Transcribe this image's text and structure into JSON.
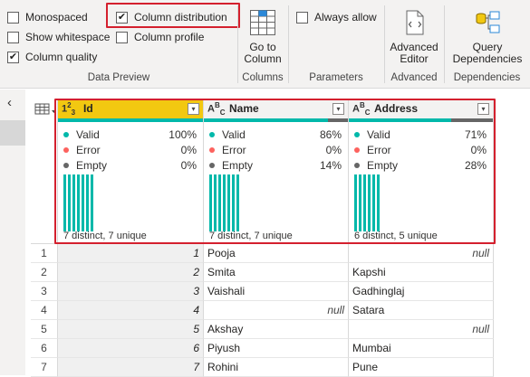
{
  "ribbon": {
    "checks": [
      {
        "label": "Monospaced",
        "checked": false
      },
      {
        "label": "Show whitespace",
        "checked": false
      },
      {
        "label": "Column quality",
        "checked": true
      },
      {
        "label": "Column distribution",
        "checked": true
      },
      {
        "label": "Column profile",
        "checked": false
      },
      {
        "label": "Always allow",
        "checked": false
      }
    ],
    "check_mark": "✔",
    "groups": {
      "data_preview": "Data Preview",
      "columns": "Columns",
      "parameters": "Parameters",
      "advanced": "Advanced",
      "dependencies": "Dependencies"
    },
    "buttons": {
      "go_to_column": [
        "Go to",
        "Column"
      ],
      "advanced_editor": [
        "Advanced",
        "Editor"
      ],
      "query_dependencies": [
        "Query",
        "Dependencies"
      ]
    }
  },
  "nav": {
    "collapse": "‹"
  },
  "columns": [
    {
      "type": "1²₃",
      "name": "Id",
      "header_bg": "#f2c811",
      "dropdown": "▾",
      "quality": [
        {
          "label": "Valid",
          "value": "100%",
          "color": "#01b8aa"
        },
        {
          "label": "Error",
          "value": "0%",
          "color": "#fd625e"
        },
        {
          "label": "Empty",
          "value": "0%",
          "color": "#666666"
        }
      ],
      "valid_fraction": 1.0,
      "bars": 7,
      "distinct": "7 distinct, 7 unique"
    },
    {
      "type": "A^B_C",
      "name": "Name",
      "header_bg": "#f3f2f1",
      "dropdown": "▾",
      "quality": [
        {
          "label": "Valid",
          "value": "86%",
          "color": "#01b8aa"
        },
        {
          "label": "Error",
          "value": "0%",
          "color": "#fd625e"
        },
        {
          "label": "Empty",
          "value": "14%",
          "color": "#666666"
        }
      ],
      "valid_fraction": 0.86,
      "bars": 7,
      "distinct": "7 distinct, 7 unique"
    },
    {
      "type": "A^B_C",
      "name": "Address",
      "header_bg": "#f3f2f1",
      "dropdown": "▾",
      "quality": [
        {
          "label": "Valid",
          "value": "71%",
          "color": "#01b8aa"
        },
        {
          "label": "Error",
          "value": "0%",
          "color": "#fd625e"
        },
        {
          "label": "Empty",
          "value": "28%",
          "color": "#666666"
        }
      ],
      "valid_fraction": 0.71,
      "bars": 6,
      "distinct": "6 distinct, 5 unique"
    }
  ],
  "rows": [
    {
      "n": "1",
      "id": "1",
      "name": "Pooja",
      "address": "null"
    },
    {
      "n": "2",
      "id": "2",
      "name": "Smita",
      "address": "Kapshi"
    },
    {
      "n": "3",
      "id": "3",
      "name": "Vaishali",
      "address": "Gadhinglaj"
    },
    {
      "n": "4",
      "id": "4",
      "name": "null",
      "address": "Satara"
    },
    {
      "n": "5",
      "id": "5",
      "name": "Akshay",
      "address": "null"
    },
    {
      "n": "6",
      "id": "6",
      "name": "Piyush",
      "address": "Mumbai"
    },
    {
      "n": "7",
      "id": "7",
      "name": "Rohini",
      "address": "Pune"
    }
  ],
  "colors": {
    "valid": "#01b8aa",
    "highlight": "#d4202e",
    "empty": "#666666"
  }
}
